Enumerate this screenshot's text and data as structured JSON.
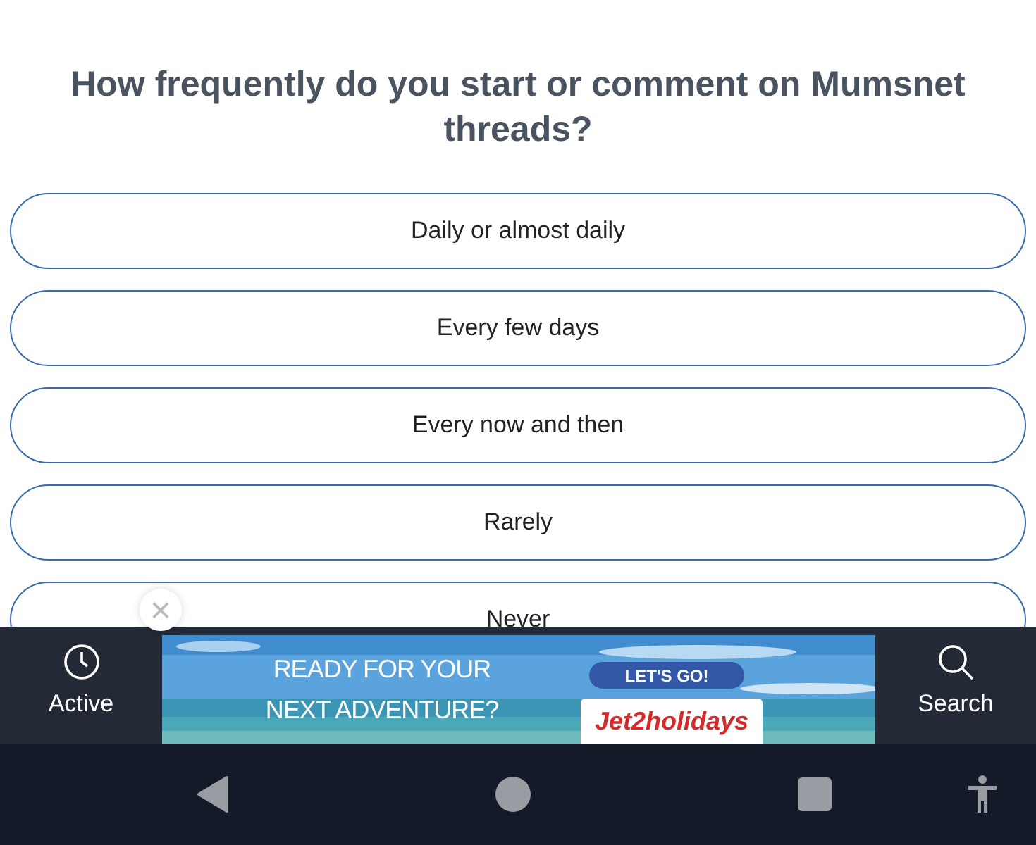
{
  "question": "How frequently do you start or comment on Mumsnet threads?",
  "options": [
    {
      "label": "Daily or almost daily"
    },
    {
      "label": "Every few days"
    },
    {
      "label": "Every now and then"
    },
    {
      "label": "Rarely"
    },
    {
      "label": "Never"
    }
  ],
  "close_button": "×",
  "bottom_bar": {
    "left": {
      "label": "Active"
    },
    "right": {
      "label": "Search"
    }
  },
  "ad": {
    "kind": "picture",
    "headline": [
      "READY FOR YOUR",
      "NEXT ADVENTURE?"
    ],
    "button": "LET'S GO!",
    "brand": "Jet2holidays"
  }
}
